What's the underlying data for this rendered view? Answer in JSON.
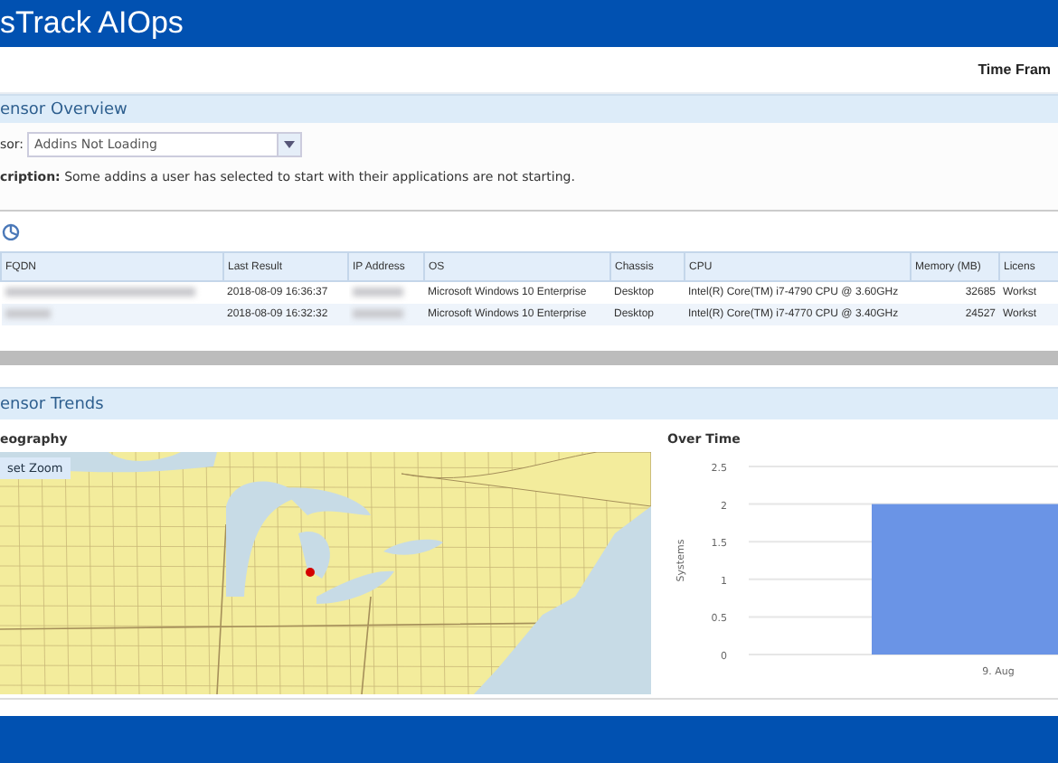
{
  "app": {
    "title": "sTrack AIOps"
  },
  "toolbar": {
    "time_frame_label": "Time Fram"
  },
  "sensor_overview": {
    "title": "ensor Overview",
    "sensor_label": "sor:",
    "sensor_value": "Addins Not Loading",
    "description": "**cription:** Some addins a user has selected to start with their applications are not starting.",
    "table": {
      "columns": [
        "FQDN",
        "Last Result",
        "IP Address",
        "OS",
        "Chassis",
        "CPU",
        "Memory (MB)",
        "Licens"
      ],
      "rows": [
        {
          "fqdn_blurred": true,
          "last_result": "2018-08-09 16:36:37",
          "ip_blurred": true,
          "os": "Microsoft Windows 10 Enterprise",
          "chassis": "Desktop",
          "cpu": "Intel(R) Core(TM) i7-4790 CPU @ 3.60GHz",
          "memory": "32685",
          "license": "Workst"
        },
        {
          "fqdn_blurred": true,
          "last_result": "2018-08-09 16:32:32",
          "ip_blurred": true,
          "os": "Microsoft Windows 10 Enterprise",
          "chassis": "Desktop",
          "cpu": "Intel(R) Core(TM) i7-4770 CPU @ 3.40GHz",
          "memory": "24527",
          "license": "Workst"
        }
      ]
    }
  },
  "sensor_trends": {
    "title": "ensor Trends",
    "geography": {
      "title": "eography",
      "reset_zoom": "set Zoom"
    },
    "over_time": {
      "chart_data": {
        "type": "bar",
        "grid": true,
        "title": "Over Time",
        "ylabel": "Systems",
        "categories": [
          "9. Aug"
        ],
        "values": [
          2
        ],
        "ylim": [
          0,
          2.5
        ],
        "yticks": [
          0,
          0.5,
          1,
          1.5,
          2,
          2.5
        ]
      }
    }
  }
}
